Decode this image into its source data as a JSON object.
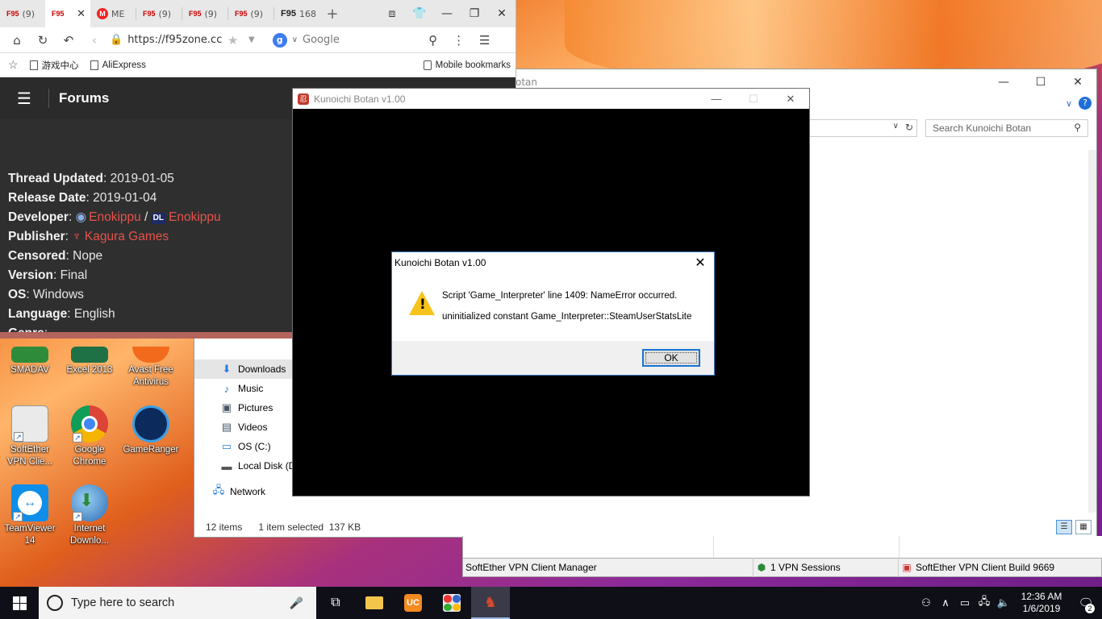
{
  "browser": {
    "tabs": [
      {
        "label": "(9)",
        "favicon": "F95"
      },
      {
        "label": "",
        "favicon": "F95"
      },
      {
        "label": "ME",
        "favicon": "M"
      },
      {
        "label": "(9)",
        "favicon": "F95"
      },
      {
        "label": "(9)",
        "favicon": "F95"
      },
      {
        "label": "(9)",
        "favicon": "F95"
      },
      {
        "label": "168",
        "favicon": "F95"
      }
    ],
    "url": "https://f95zone.cc",
    "search_placeholder": "Google",
    "bookmarks": [
      "游戏中心",
      "AliExpress"
    ],
    "mobile_bookmarks": "Mobile bookmarks",
    "site": {
      "header": "Forums",
      "fields": [
        {
          "label": "Thread Updated",
          "value": "2019-01-05"
        },
        {
          "label": "Release Date",
          "value": "2019-01-04"
        },
        {
          "label": "Developer",
          "value": "Enokippu",
          "value2": "Enokippu",
          "badge": "DL"
        },
        {
          "label": "Publisher",
          "value": "Kagura Games"
        },
        {
          "label": "Censored",
          "value": "Nope"
        },
        {
          "label": "Version",
          "value": "Final"
        },
        {
          "label": "OS",
          "value": "Windows"
        },
        {
          "label": "Language",
          "value": "English"
        },
        {
          "label": "Genre",
          "value": ""
        }
      ]
    }
  },
  "desktop_icons": [
    {
      "label": "SMADAV",
      "color": "#2e8b3a"
    },
    {
      "label": "Excel 2013",
      "color": "#1e7145"
    },
    {
      "label": "Avast Free Antivirus",
      "color": "#f26b1d"
    },
    {
      "label": "SoftEther VPN Clie...",
      "color": "#e8e8e8"
    },
    {
      "label": "Google Chrome",
      "color": "#db4437"
    },
    {
      "label": "GameRanger",
      "color": "#0d2a5c"
    },
    {
      "label": "TeamViewer 14",
      "color": "#0e8ee9"
    },
    {
      "label": "Internet Downlo...",
      "color": "#2d8a3a"
    }
  ],
  "explorer": {
    "title_fragment": "otan",
    "search_placeholder": "Search Kunoichi Botan",
    "nav_items": [
      {
        "label": "Downloads",
        "icon": "download-icon",
        "glyph": "⬇",
        "selected": true
      },
      {
        "label": "Music",
        "icon": "music-icon",
        "glyph": "♪"
      },
      {
        "label": "Pictures",
        "icon": "pictures-icon",
        "glyph": "▣"
      },
      {
        "label": "Videos",
        "icon": "videos-icon",
        "glyph": "▤"
      },
      {
        "label": "OS (C:)",
        "icon": "drive-icon",
        "glyph": "▭"
      },
      {
        "label": "Local Disk (D:",
        "icon": "disk-icon",
        "glyph": "▬"
      }
    ],
    "network": "Network",
    "status_items": "12 items",
    "status_selected": "1 item selected",
    "status_size": "137 KB"
  },
  "vpn": {
    "manager": "SoftEther VPN Client Manager",
    "sessions": "1 VPN Sessions",
    "build": "SoftEther VPN Client Build 9669"
  },
  "game": {
    "title": "Kunoichi Botan v1.00"
  },
  "dialog": {
    "title": "Kunoichi Botan v1.00",
    "line1": "Script 'Game_Interpreter' line 1409: NameError occurred.",
    "line2": "uninitialized constant Game_Interpreter::SteamUserStatsLite",
    "ok": "OK"
  },
  "taskbar": {
    "search_placeholder": "Type here to search",
    "time": "12:36 AM",
    "date": "1/6/2019",
    "notifications": "2"
  }
}
